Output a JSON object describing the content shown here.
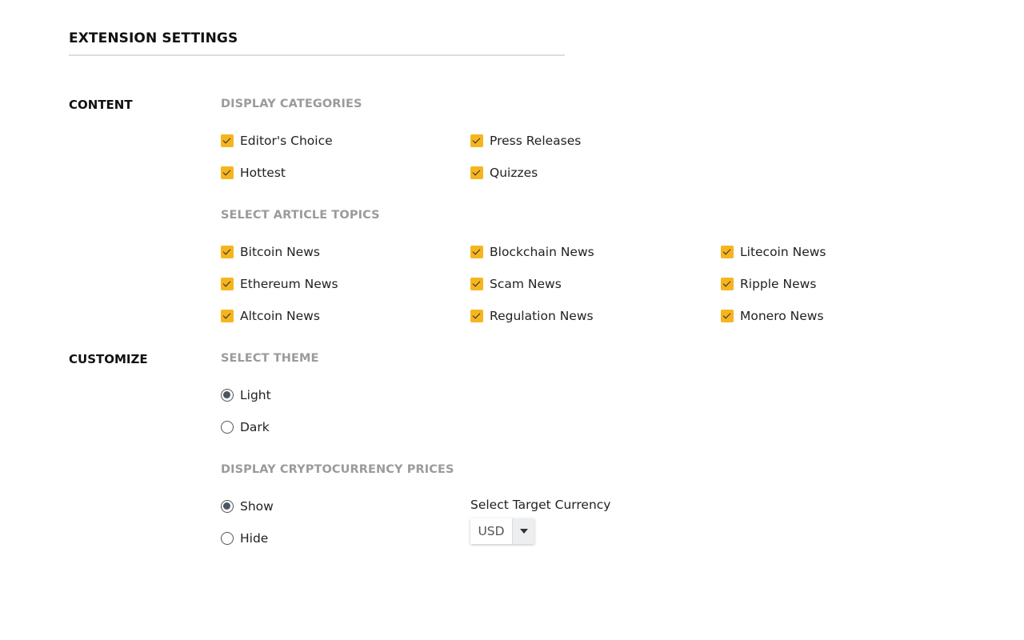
{
  "page": {
    "title": "EXTENSION SETTINGS"
  },
  "colors": {
    "checkbox_fill": "#f6b51d",
    "heading_gray": "#9b9b9b",
    "radio_dot": "#4a5563"
  },
  "content": {
    "label": "CONTENT",
    "display_categories": {
      "heading": "DISPLAY CATEGORIES",
      "items": [
        {
          "label": "Editor's Choice",
          "checked": true
        },
        {
          "label": "Press Releases",
          "checked": true
        },
        {
          "label": "Hottest",
          "checked": true
        },
        {
          "label": "Quizzes",
          "checked": true
        }
      ]
    },
    "article_topics": {
      "heading": "SELECT ARTICLE TOPICS",
      "items": [
        {
          "label": "Bitcoin News",
          "checked": true
        },
        {
          "label": "Blockchain News",
          "checked": true
        },
        {
          "label": "Litecoin News",
          "checked": true
        },
        {
          "label": "Ethereum News",
          "checked": true
        },
        {
          "label": "Scam News",
          "checked": true
        },
        {
          "label": "Ripple News",
          "checked": true
        },
        {
          "label": "Altcoin News",
          "checked": true
        },
        {
          "label": "Regulation News",
          "checked": true
        },
        {
          "label": "Monero News",
          "checked": true
        }
      ]
    }
  },
  "customize": {
    "label": "CUSTOMIZE",
    "theme": {
      "heading": "SELECT THEME",
      "options": [
        {
          "label": "Light",
          "selected": true
        },
        {
          "label": "Dark",
          "selected": false
        }
      ]
    },
    "prices": {
      "heading": "DISPLAY CRYPTOCURRENCY PRICES",
      "options": [
        {
          "label": "Show",
          "selected": true
        },
        {
          "label": "Hide",
          "selected": false
        }
      ],
      "currency": {
        "label": "Select Target Currency",
        "value": "USD"
      }
    }
  }
}
